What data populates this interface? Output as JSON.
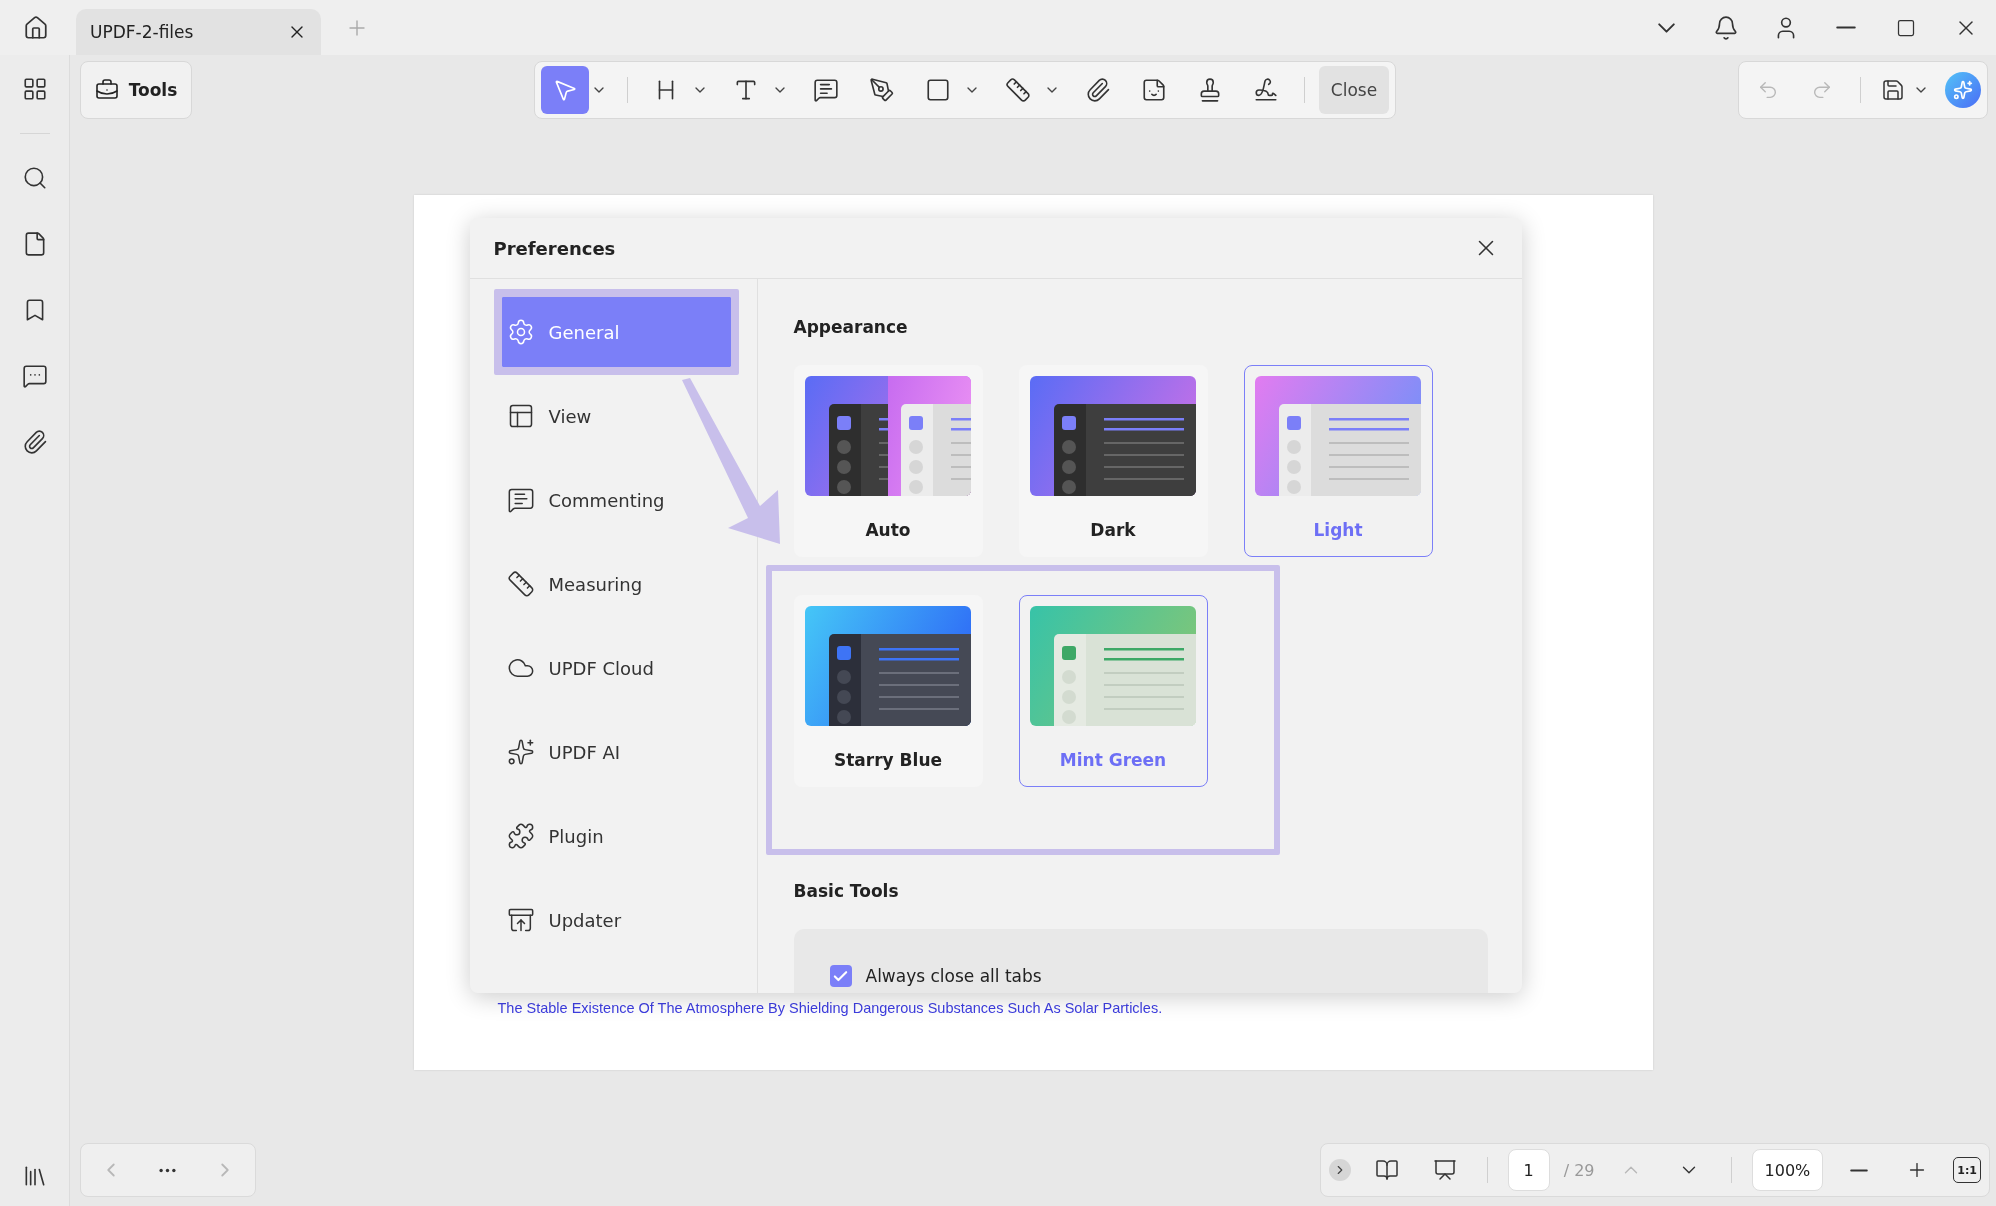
{
  "tabs": [
    {
      "label": "UPDF-2-files",
      "selected": true
    }
  ],
  "toolbar": {
    "tools_label": "Tools",
    "tools": [
      {
        "kind": "select",
        "selected": true,
        "dropdown": true
      },
      {
        "kind": "heading",
        "selected": false,
        "dropdown": true
      },
      {
        "kind": "text",
        "selected": false,
        "dropdown": true
      },
      {
        "kind": "comment",
        "selected": false,
        "dropdown": false
      },
      {
        "kind": "pen",
        "selected": false,
        "dropdown": false
      },
      {
        "kind": "shape",
        "selected": false,
        "dropdown": true
      },
      {
        "kind": "measure",
        "selected": false,
        "dropdown": true
      },
      {
        "kind": "attach",
        "selected": false,
        "dropdown": false
      },
      {
        "kind": "sticker",
        "selected": false,
        "dropdown": false
      },
      {
        "kind": "stamp",
        "selected": false,
        "dropdown": false
      },
      {
        "kind": "signature",
        "selected": false,
        "dropdown": false
      }
    ],
    "close_label": "Close",
    "history": [
      {
        "kind": "undo",
        "disabled": true
      },
      {
        "kind": "redo",
        "disabled": true
      }
    ]
  },
  "document": {
    "text": "The Stable Existence Of The Atmosphere By Shielding Dangerous Substances Such As Solar Particles."
  },
  "dialog": {
    "title": "Preferences",
    "nav": [
      {
        "label": "General",
        "kind": "gear",
        "selected": true,
        "highlighted": true
      },
      {
        "label": "View",
        "kind": "layout",
        "selected": false,
        "highlighted": false
      },
      {
        "label": "Commenting",
        "kind": "comment",
        "selected": false,
        "highlighted": false
      },
      {
        "label": "Measuring",
        "kind": "ruler",
        "selected": false,
        "highlighted": false
      },
      {
        "label": "UPDF Cloud",
        "kind": "cloud",
        "selected": false,
        "highlighted": false
      },
      {
        "label": "UPDF AI",
        "kind": "sparkle",
        "selected": false,
        "highlighted": false
      },
      {
        "label": "Plugin",
        "kind": "puzzle",
        "selected": false,
        "highlighted": false
      },
      {
        "label": "Updater",
        "kind": "upload",
        "selected": false,
        "highlighted": false
      }
    ],
    "appearance": {
      "heading": "Appearance",
      "rows": [
        {
          "highlighted": false,
          "themes": [
            {
              "name": "Auto",
              "kind": "auto",
              "selected": false
            },
            {
              "name": "Dark",
              "kind": "dark",
              "selected": false
            },
            {
              "name": "Light",
              "kind": "light",
              "selected": true
            }
          ]
        },
        {
          "highlighted": true,
          "themes": [
            {
              "name": "Starry Blue",
              "kind": "starry",
              "selected": false
            },
            {
              "name": "Mint Green",
              "kind": "mint",
              "selected": true
            }
          ]
        }
      ]
    },
    "basic_tools": {
      "heading": "Basic Tools",
      "options": [
        {
          "label": "Always close all tabs",
          "checked": true
        }
      ]
    }
  },
  "page_nav": {
    "current": "1",
    "total": "/ 29",
    "zoom": "100%",
    "ratio": "1:1",
    "prev_disabled": true,
    "next_disabled": false
  }
}
